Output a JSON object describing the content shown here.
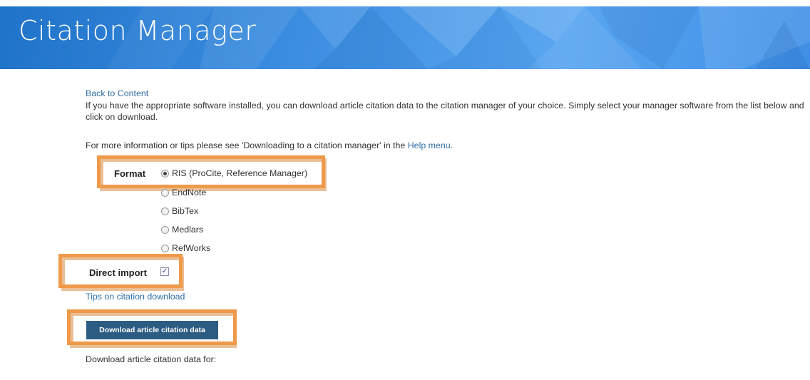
{
  "banner": {
    "title": "Citation Manager"
  },
  "page": {
    "back_link": "Back to Content",
    "intro": "If you have the appropriate software installed, you can download article citation data to the citation manager of your choice. Simply select your manager software from the list below and click on download.",
    "more_info_prefix": "For more information or tips please see 'Downloading to a citation manager' in the ",
    "help_link": "Help menu",
    "more_info_suffix": "."
  },
  "format": {
    "label": "Format",
    "selected": "RIS (ProCite, Reference Manager)",
    "options": [
      "RIS (ProCite, Reference Manager)",
      "EndNote",
      "BibTex",
      "Medlars",
      "RefWorks"
    ]
  },
  "direct_import": {
    "label": "Direct import",
    "checked": true
  },
  "tips_link": "Tips on citation download",
  "download_button": "Download article citation data",
  "download_for": "Download article citation data for:",
  "colors": {
    "banner": "#3a8ce0",
    "link": "#2f6ea3",
    "button": "#2c5c82",
    "highlight": "#ef9a4a"
  }
}
